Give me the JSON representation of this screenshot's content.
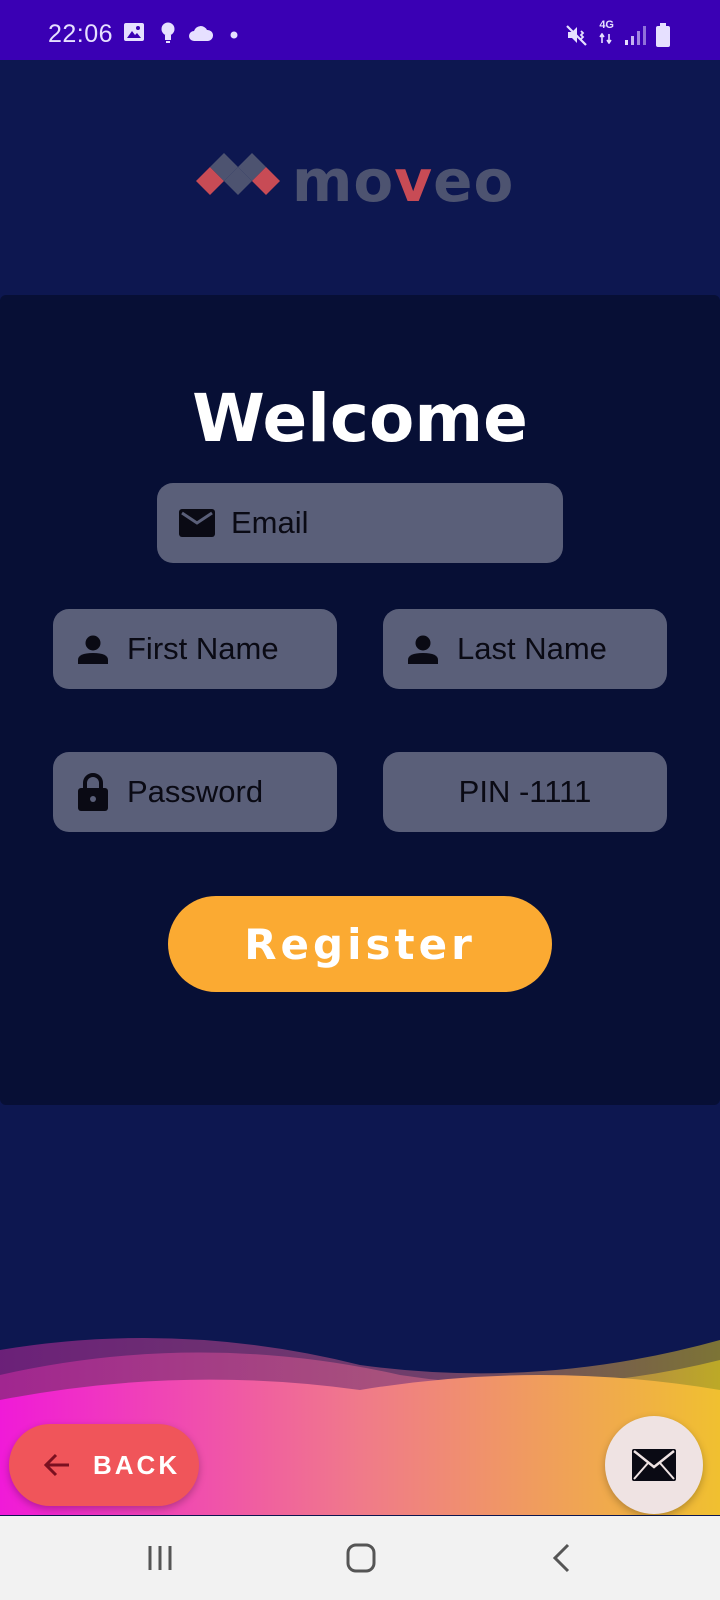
{
  "status_bar": {
    "time": "22:06",
    "left_icons": [
      "image-icon",
      "bulb-icon",
      "cloud-icon",
      "dot-icon"
    ],
    "network": "4G",
    "right_icons": [
      "mute-vibrate-icon",
      "network-4g-icon",
      "signal-icon",
      "battery-icon"
    ]
  },
  "logo": {
    "text_before": "mo",
    "text_v": "v",
    "text_after": "eo"
  },
  "form": {
    "title": "Welcome",
    "email_placeholder": "Email",
    "first_name_placeholder": "First Name",
    "last_name_placeholder": "Last Name",
    "password_placeholder": "Password",
    "pin_placeholder": "PIN -1111",
    "register_label": "Register"
  },
  "footer": {
    "back_label": "BACK",
    "mail_button_icon": "envelope-icon"
  },
  "nav_bar": {
    "buttons": [
      "recent-apps-icon",
      "home-icon",
      "back-nav-icon"
    ]
  },
  "colors": {
    "status_bar": "#3a00b4",
    "background": "#0d1750",
    "card": "#070f35",
    "field": "#5a5f79",
    "register": "#fbaa32",
    "back_button": "#f0555a",
    "logo_accent": "#c84b55"
  }
}
